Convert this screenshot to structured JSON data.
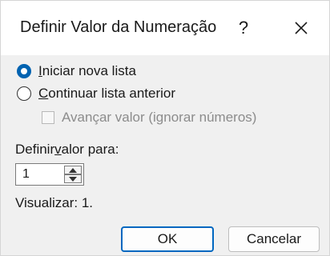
{
  "window": {
    "title": "Definir Valor da Numeração",
    "help_label": "?"
  },
  "options": {
    "start_new": {
      "prefix": "",
      "accel": "I",
      "suffix": "niciar nova lista",
      "checked": true
    },
    "continue": {
      "prefix": "",
      "accel": "C",
      "suffix": "ontinuar lista anterior",
      "checked": false
    },
    "advance": {
      "label": "Avançar valor (ignorar números)",
      "checked": false,
      "enabled": false
    }
  },
  "set_value": {
    "label_prefix": "Definir ",
    "label_accel": "v",
    "label_suffix": "alor para:",
    "value": "1"
  },
  "preview": {
    "text": "Visualizar: 1."
  },
  "buttons": {
    "ok": "OK",
    "cancel": "Cancelar"
  },
  "colors": {
    "accent": "#0063b1",
    "default_button_border": "#0067c0"
  },
  "icons": {
    "close": "close-icon",
    "spin_up": "arrow-up-icon",
    "spin_down": "arrow-down-icon"
  }
}
